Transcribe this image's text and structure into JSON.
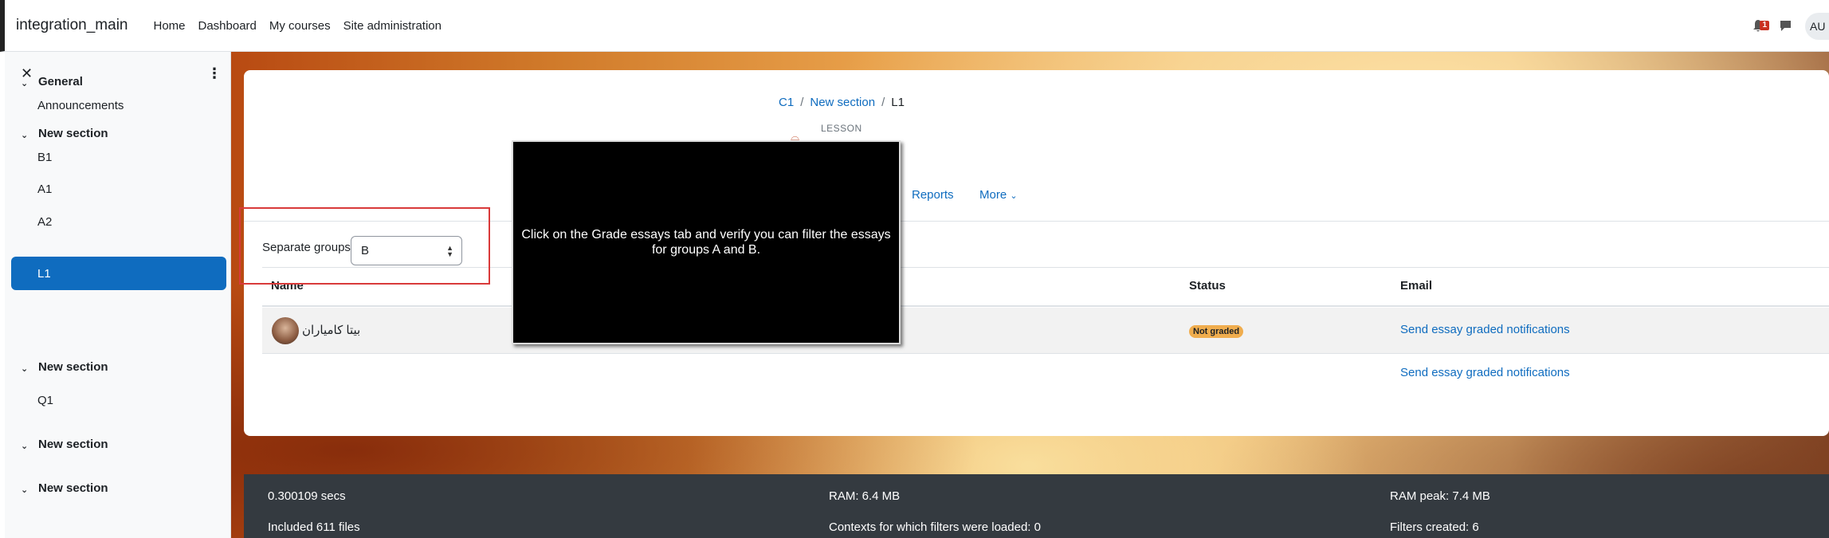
{
  "header": {
    "brand": "integration_main",
    "nav": [
      "Home",
      "Dashboard",
      "My courses",
      "Site administration"
    ],
    "notification_count": "1",
    "user_initials": "AU"
  },
  "sidebar": {
    "sections": [
      {
        "title": "General",
        "items": [
          "Announcements"
        ]
      },
      {
        "title": "New section",
        "items": [
          "B1",
          "A1",
          "A2",
          "L1"
        ]
      },
      {
        "title": "New section",
        "items": [
          "Q1"
        ]
      },
      {
        "title": "New section",
        "items": []
      },
      {
        "title": "New section",
        "items": []
      }
    ],
    "active_item": "L1"
  },
  "breadcrumb": [
    "C1",
    "New section",
    "L1"
  ],
  "activity": {
    "type_label": "LESSON"
  },
  "tabs": {
    "reports": "Reports",
    "more": "More"
  },
  "groups": {
    "label": "Separate groups",
    "selected": "B"
  },
  "table": {
    "headers": {
      "name": "Name",
      "status": "Status",
      "email": "Email"
    },
    "rows": [
      {
        "name": "بیتا کامیاران",
        "status": "Not graded",
        "email": "Send essay graded notifications"
      }
    ],
    "footer_link": "Send essay graded notifications"
  },
  "overlay": {
    "text": "Click on the Grade essays tab and verify you can filter the essays for groups A and B."
  },
  "perf_footer": {
    "col1": [
      "0.300109 secs",
      "Included 611 files"
    ],
    "col2": [
      "RAM: 6.4 MB",
      "Contexts for which filters were loaded: 0"
    ],
    "col3": [
      "RAM peak: 7.4 MB",
      "Filters created: 6"
    ]
  },
  "colors": {
    "brand_blue": "#0f6cbf",
    "badge_warning": "#f0ad4e",
    "highlight_red": "#d93a3a",
    "footer_bg": "#343a40"
  }
}
